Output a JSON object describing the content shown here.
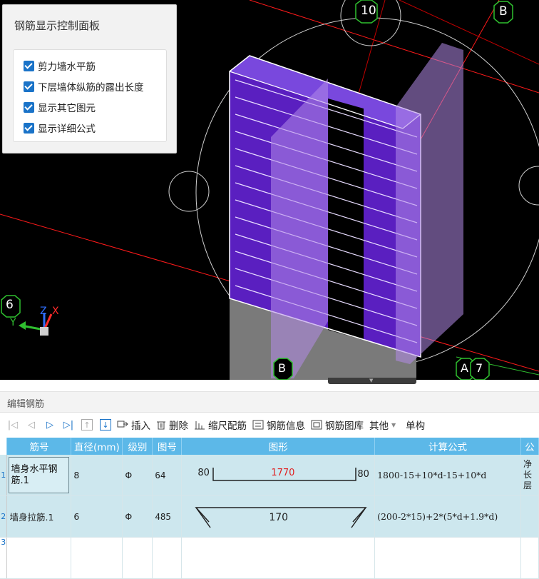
{
  "viewport": {
    "axis_numbers": {
      "top_ten": "10",
      "top_b": "B",
      "left_six": "6",
      "bottom_b": "B",
      "bottom_a": "A",
      "bottom_seven": "7"
    },
    "triad": {
      "x": "X",
      "y": "Y",
      "z": "Z"
    },
    "colors": {
      "background": "#000000",
      "wall": "#6a2fc9",
      "bars": "#c8a6f0",
      "axis_red": "#ff1a1a",
      "axis_green": "#2fbf2f"
    }
  },
  "control_panel": {
    "title": "钢筋显示控制面板",
    "options": [
      {
        "label": "剪力墙水平筋",
        "checked": true
      },
      {
        "label": "下层墙体纵筋的露出长度",
        "checked": true
      },
      {
        "label": "显示其它图元",
        "checked": true
      },
      {
        "label": "显示详细公式",
        "checked": true
      }
    ]
  },
  "editor": {
    "title": "编辑钢筋",
    "toolbar": {
      "insert": "插入",
      "delete": "删除",
      "scale_config": "缩尺配筋",
      "rebar_info": "钢筋信息",
      "rebar_library": "钢筋图库",
      "other": "其他",
      "single": "单构"
    },
    "columns": [
      "筋号",
      "直径(mm)",
      "级别",
      "图号",
      "图形",
      "计算公式",
      "公"
    ],
    "rows": [
      {
        "num": "1",
        "name": "墙身水平钢筋.1",
        "diameter": "8",
        "grade": "Φ",
        "shape_no": "64",
        "shape": {
          "left": "80",
          "mid": "1770",
          "right": "80"
        },
        "formula": "1800-15+10*d-15+10*d",
        "extra": "净长层"
      },
      {
        "num": "2",
        "name": "墙身拉筋.1",
        "diameter": "6",
        "grade": "Φ",
        "shape_no": "485",
        "shape": {
          "mid": "170"
        },
        "formula": "(200-2*15)+2*(5*d+1.9*d)",
        "extra": ""
      }
    ],
    "next_row_num": "3"
  }
}
